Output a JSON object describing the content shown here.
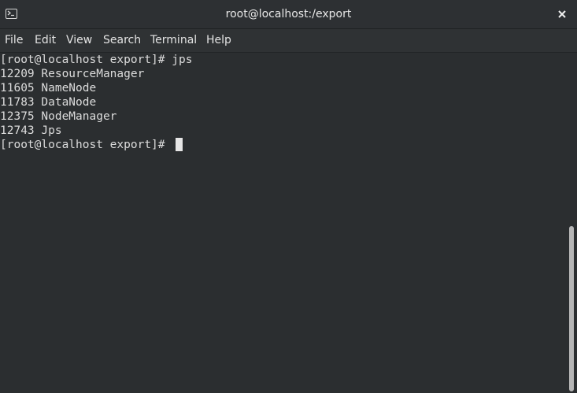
{
  "window": {
    "title": "root@localhost:/export",
    "icon": "terminal-icon",
    "close_icon": "close-icon"
  },
  "menu": {
    "items": [
      {
        "label": "File"
      },
      {
        "label": "Edit"
      },
      {
        "label": "View"
      },
      {
        "label": "Search"
      },
      {
        "label": "Terminal"
      },
      {
        "label": "Help"
      }
    ]
  },
  "terminal": {
    "lines": [
      "[root@localhost export]# jps",
      "12209 ResourceManager",
      "11605 NameNode",
      "11783 DataNode",
      "12375 NodeManager",
      "12743 Jps",
      "[root@localhost export]# "
    ]
  },
  "colors": {
    "background": "#2b2e30",
    "text": "#dcdcdc",
    "cursor": "#e6e6e6",
    "scroll_thumb": "#b6b6b6"
  }
}
